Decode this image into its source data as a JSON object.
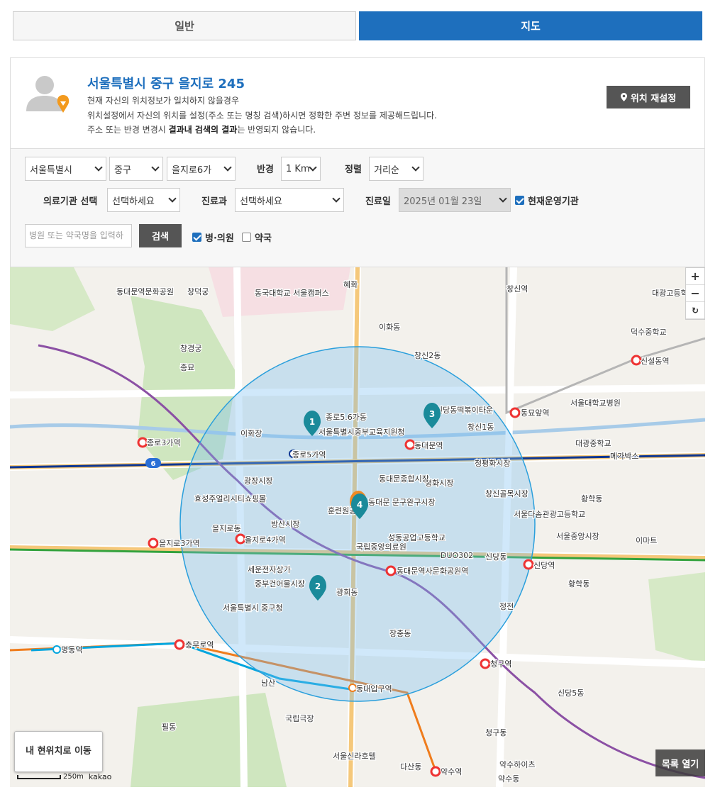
{
  "tabs": [
    {
      "label": "일반",
      "active": false
    },
    {
      "label": "지도",
      "active": true
    }
  ],
  "location": {
    "title": "서울특별시 중구 을지로 245",
    "desc_line1": "현재 자신의 위치정보가 일치하지 않을경우",
    "desc_line2": "위치설정에서 자신의 위치를 설정(주소 또는 명칭 검색)하시면 정확한 주변 정보를 제공해드립니다.",
    "desc_line3_pre": "주소 또는 반경 변경시 ",
    "desc_line3_bold": "결과내 검색의 결과",
    "desc_line3_post": "는 반영되지 않습니다.",
    "reset_button": "위치 재설정"
  },
  "filters": {
    "sido": "서울특별시",
    "gu": "중구",
    "dong": "을지로6가",
    "radius_label": "반경",
    "radius": "1 Km",
    "sort_label": "정렬",
    "sort": "거리순",
    "institution_label": "의료기관 선택",
    "institution": "선택하세요",
    "dept_label": "진료과",
    "dept": "선택하세요",
    "date_label": "진료일",
    "date": "2025년 01월 23일",
    "operating_label": "현재운영기관",
    "operating_checked": true,
    "search_placeholder": "병원 또는 약국명을 입력하",
    "search_button": "검색",
    "hospital_label": "병·의원",
    "hospital_checked": true,
    "pharmacy_label": "약국",
    "pharmacy_checked": false
  },
  "map": {
    "zoom_in": "+",
    "zoom_out": "−",
    "reset_icon": "↻",
    "my_location": "내 현위치로 이동",
    "list_open": "목록 열기",
    "scale_label": "250m",
    "brand": "kakao",
    "markers": [
      "1",
      "2",
      "3",
      "4"
    ],
    "line_badge": "6",
    "labels": [
      "종로5가역",
      "동대문역",
      "을지로4가역",
      "동대문역사문화공원역",
      "을지로3가역",
      "충무로역",
      "신당역",
      "청구역",
      "동대입구역",
      "종로3가역",
      "창신역",
      "동묘앞역",
      "약수역",
      "명동역",
      "신설동역",
      "서울특별시중부교육지원청",
      "국립중앙의료원",
      "광장시장",
      "방산시장",
      "평화시장",
      "동대문종합시장",
      "중부건어물시장",
      "서울중앙시장",
      "신당동",
      "황학동",
      "창신2동",
      "창신1동",
      "종로5.6가동",
      "을지로동",
      "광희동",
      "장충동",
      "서울특별시 중구청",
      "훈련원공원",
      "동대문 문구완구시장",
      "청평화시장",
      "창신골목시장",
      "신당동떡볶이타운",
      "정전",
      "종묘",
      "창경궁",
      "창덕궁",
      "동대문역문화공원",
      "DUO302",
      "이마트",
      "메가박스",
      "성동공업고등학교",
      "서울다솜관광고등학교",
      "대광중학교",
      "대광고등학교",
      "덕수중학교",
      "세운전자상가",
      "효성주얼리시티쇼핑몰",
      "이화장",
      "이화동",
      "혜화",
      "서울대학교병원",
      "동국대학교 서울캠퍼스",
      "국립극장",
      "남산",
      "필동",
      "다산동",
      "약수동",
      "청구동",
      "황학동",
      "신당5동",
      "약수하이츠",
      "서울신라호텔"
    ]
  },
  "colors": {
    "accent": "#1e6fbd",
    "button_dark": "#555555",
    "marker_teal": "#1a8a9a",
    "marker_orange": "#f08a24"
  }
}
